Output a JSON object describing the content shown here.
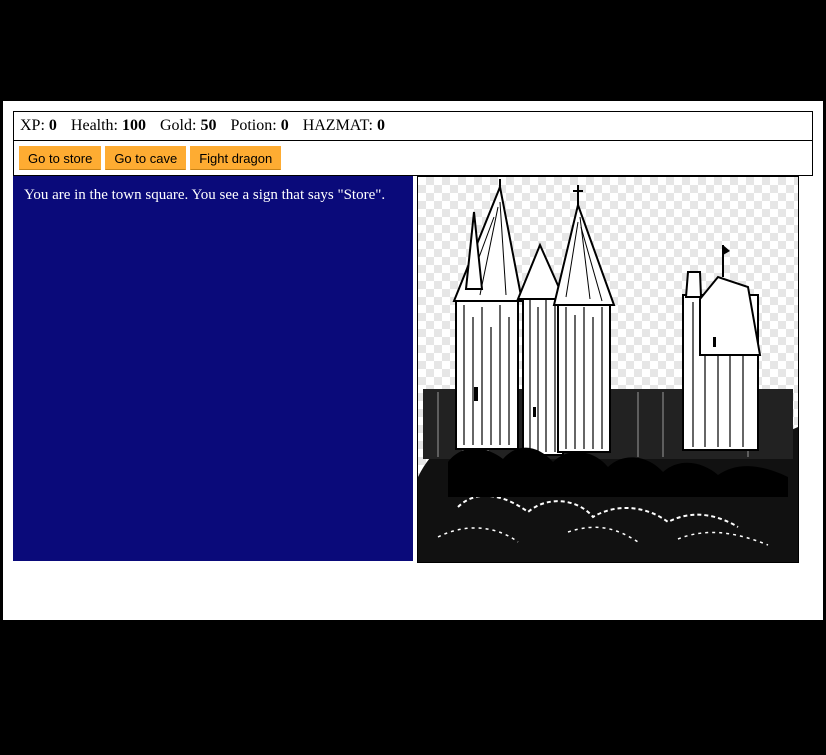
{
  "stats": [
    {
      "label": "XP:",
      "value": "0"
    },
    {
      "label": "Health:",
      "value": "100"
    },
    {
      "label": "Gold:",
      "value": "50"
    },
    {
      "label": "Potion:",
      "value": "0"
    },
    {
      "label": "HAZMAT:",
      "value": "0"
    }
  ],
  "controls": {
    "button1": "Go to store",
    "button2": "Go to cave",
    "button3": "Fight dragon"
  },
  "text": "You are in the town square. You see a sign that says \"Store\".",
  "colors": {
    "button": "#feac32",
    "text_panel": "#0a0a7a",
    "outer_background": "#000000"
  },
  "image": "castle-illustration"
}
